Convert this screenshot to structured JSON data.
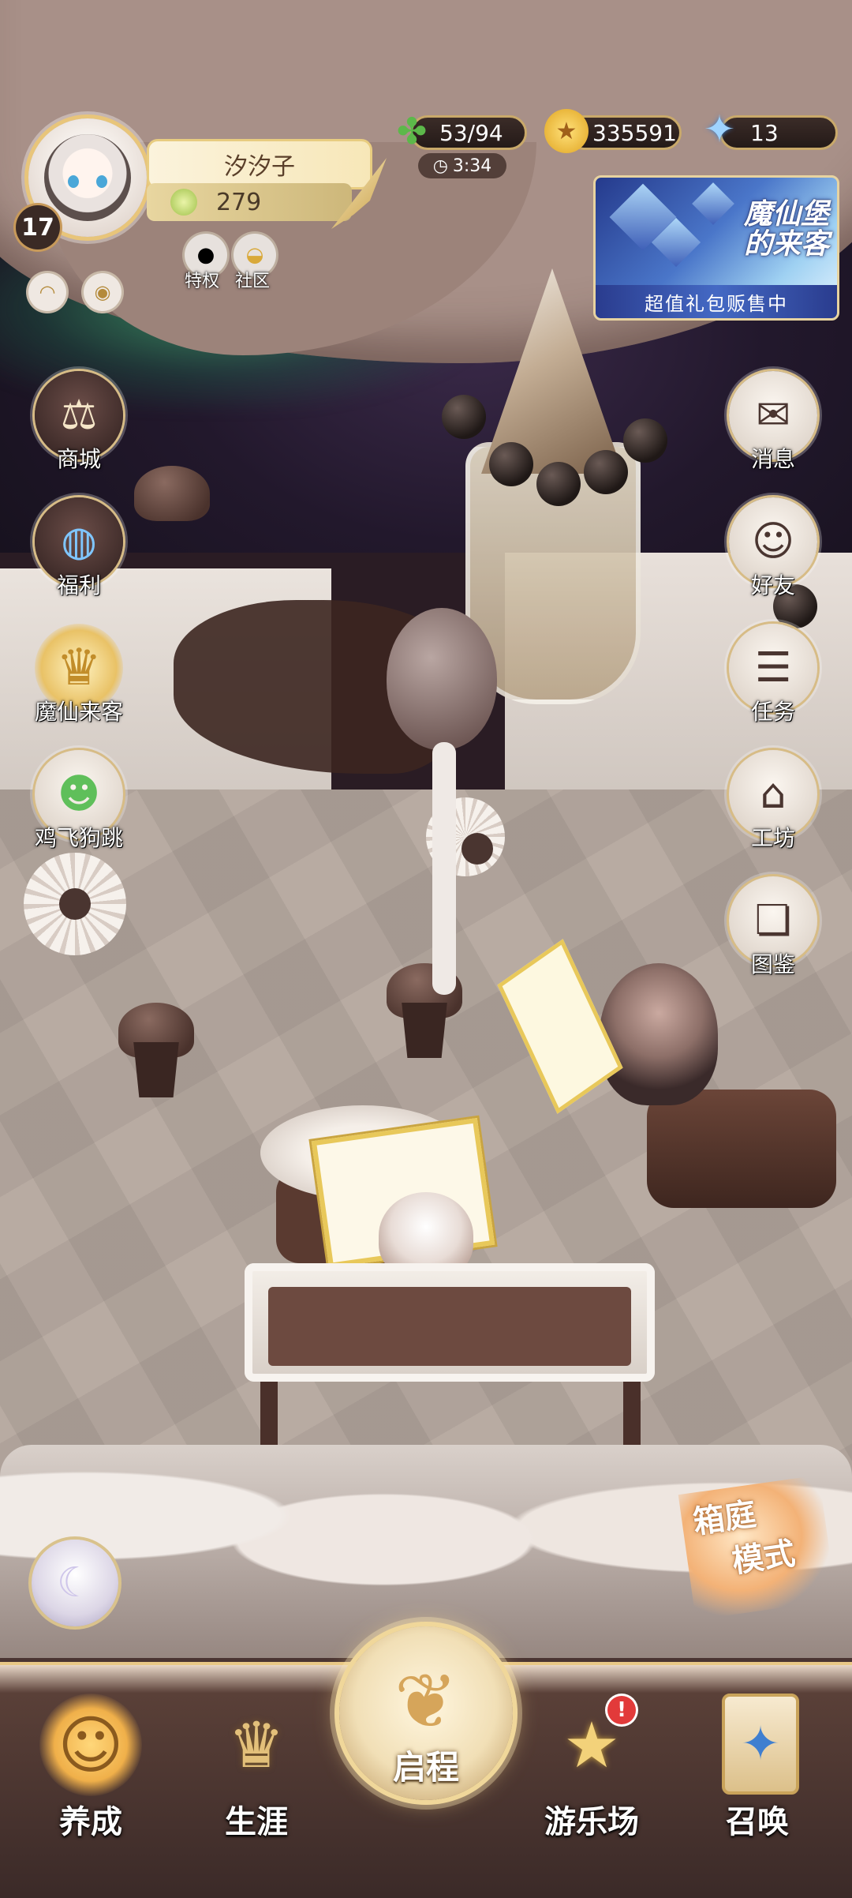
{
  "player": {
    "name": "汐汐子",
    "level": "17",
    "currency": "279"
  },
  "badges": [
    {
      "label": "特权",
      "icon": "qq-penguin-icon"
    },
    {
      "label": "社区",
      "icon": "mask-icon"
    }
  ],
  "resources": {
    "stamina": "53/94",
    "stamina_timer": "3:34",
    "gold": "335591",
    "crystal": "13"
  },
  "banner": {
    "title_line1": "魔仙堡",
    "title_line2": "的来客",
    "subtitle": "超值礼包贩售中"
  },
  "left_menu": [
    {
      "label": "商城",
      "icon": "scales-icon"
    },
    {
      "label": "福利",
      "icon": "globe-gift-icon"
    },
    {
      "label": "魔仙来客",
      "icon": "crown-icon"
    },
    {
      "label": "鸡飞狗跳",
      "icon": "green-cat-icon"
    }
  ],
  "right_menu": [
    {
      "label": "消息",
      "icon": "envelope-heart-icon"
    },
    {
      "label": "好友",
      "icon": "friend-icon"
    },
    {
      "label": "任务",
      "icon": "task-clipboard-icon"
    },
    {
      "label": "工坊",
      "icon": "workshop-frame-icon"
    },
    {
      "label": "图鉴",
      "icon": "card-album-icon"
    }
  ],
  "sandbox": {
    "line1": "箱庭",
    "line2": "模式"
  },
  "bottom_nav": [
    {
      "label": "养成",
      "icon": "sleeping-girl-icon"
    },
    {
      "label": "生涯",
      "icon": "crown-icon"
    },
    {
      "label": "启程",
      "icon": "open-book-butterfly-icon"
    },
    {
      "label": "游乐场",
      "icon": "star-park-icon"
    },
    {
      "label": "召唤",
      "icon": "summon-card-icon"
    }
  ],
  "notification": "!",
  "colors": {
    "accent_gold": "#e8c57a",
    "nav_bg": "#3b2a28",
    "notif_red": "#e23a3a"
  }
}
